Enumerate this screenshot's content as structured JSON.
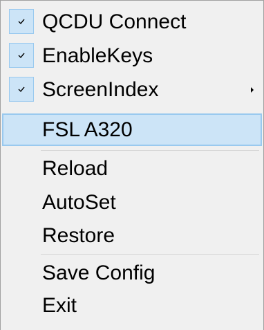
{
  "menu": {
    "items": [
      {
        "label": "QCDU Connect",
        "checked": true
      },
      {
        "label": "EnableKeys",
        "checked": true
      },
      {
        "label": "ScreenIndex",
        "checked": true,
        "has_submenu": true
      },
      {
        "label": "FSL A320",
        "highlighted": true
      },
      {
        "label": "Reload"
      },
      {
        "label": "AutoSet"
      },
      {
        "label": "Restore"
      },
      {
        "label": "Save Config"
      },
      {
        "label": "Exit"
      }
    ]
  },
  "colors": {
    "menu_background": "#f0f0f0",
    "highlight_fill": "#cce4f7",
    "highlight_border": "#99c9ef",
    "separator": "#d7d7d7"
  }
}
